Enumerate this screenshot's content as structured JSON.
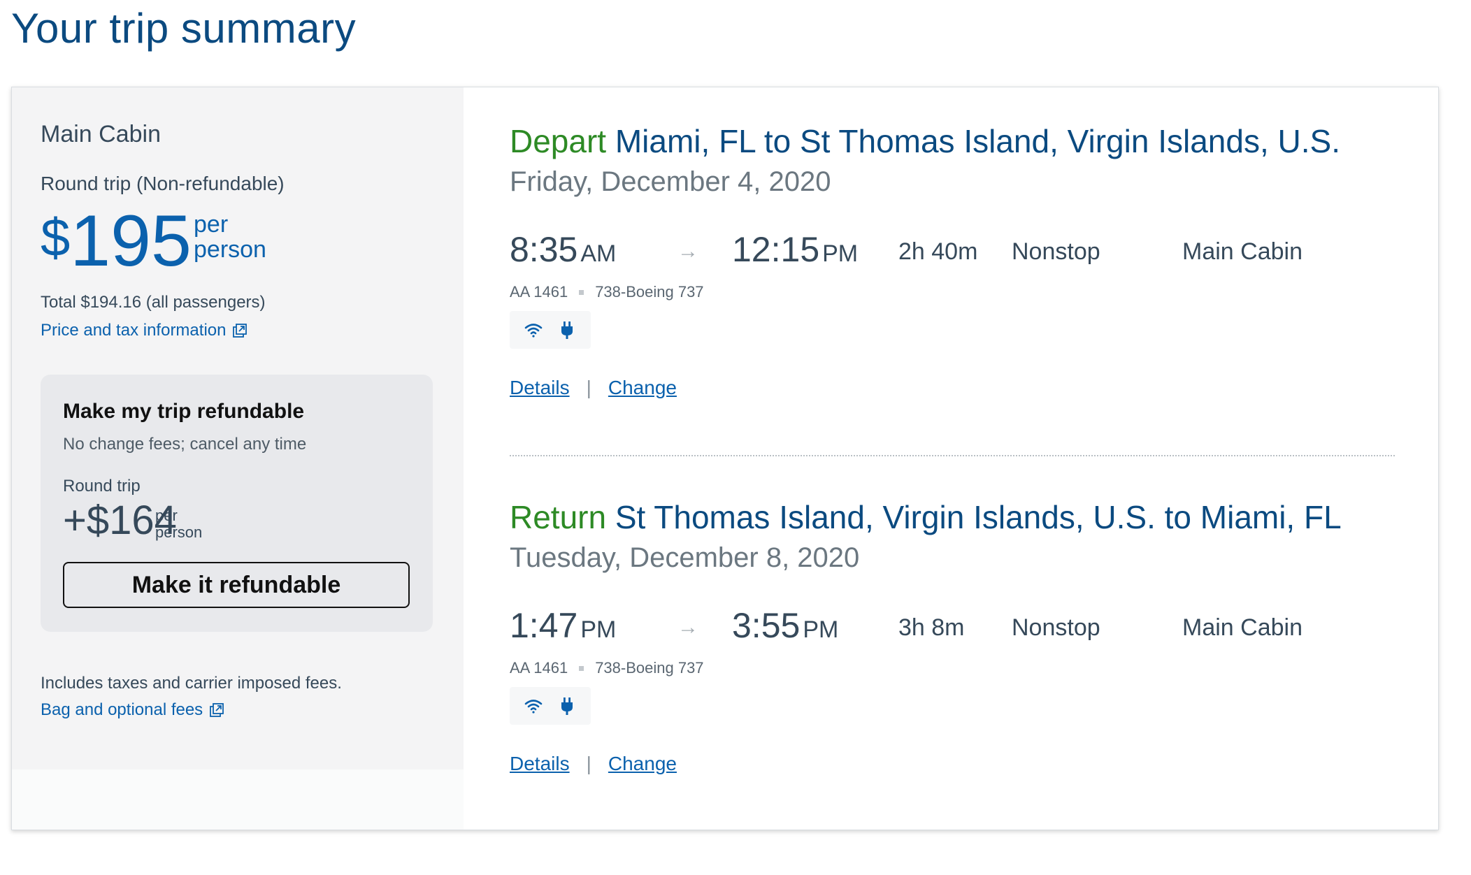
{
  "page": {
    "title": "Your trip summary"
  },
  "summary": {
    "cabin_name": "Main Cabin",
    "trip_type": "Round trip (Non-refundable)",
    "price_currency": "$",
    "price_amount": "195",
    "per_person_line1": "per",
    "per_person_line2": "person",
    "total": "Total $194.16 (all passengers)",
    "price_tax_link": "Price and tax information",
    "includes_note": "Includes taxes and carrier imposed fees.",
    "bag_fees_link": "Bag and optional fees"
  },
  "refund": {
    "title": "Make my trip refundable",
    "subtitle": "No change fees; cancel any time",
    "trip_label": "Round trip",
    "price": "+$164",
    "per_line1": "per",
    "per_line2": "person",
    "button_label": "Make it refundable"
  },
  "segments": [
    {
      "direction": "Depart",
      "route": "Miami, FL to St Thomas Island, Virgin Islands, U.S.",
      "date": "Friday, December 4, 2020",
      "depart_time": "8:35",
      "depart_ampm": "AM",
      "arrive_time": "12:15",
      "arrive_ampm": "PM",
      "duration": "2h  40m",
      "stops": "Nonstop",
      "cabin": "Main Cabin",
      "flight_number": "AA 1461",
      "aircraft": "738-Boeing 737",
      "details_link": "Details",
      "change_link": "Change"
    },
    {
      "direction": "Return",
      "route": "St Thomas Island, Virgin Islands, U.S. to Miami, FL",
      "date": "Tuesday, December 8, 2020",
      "depart_time": "1:47",
      "depart_ampm": "PM",
      "arrive_time": "3:55",
      "arrive_ampm": "PM",
      "duration": "3h  8m",
      "stops": "Nonstop",
      "cabin": "Main Cabin",
      "flight_number": "AA 1461",
      "aircraft": "738-Boeing 737",
      "details_link": "Details",
      "change_link": "Change"
    }
  ],
  "ui": {
    "link_separator": "|",
    "arrow_glyph": "→"
  },
  "icons": {
    "external_link": "external-link-icon",
    "wifi": "wifi-icon",
    "power": "power-outlet-icon",
    "arrow": "arrow-right-icon"
  },
  "colors": {
    "brand_blue": "#0b4a80",
    "link_blue": "#0b61ad",
    "depart_green": "#2d8a25",
    "sidebar_bg": "#f4f4f5",
    "refund_box_bg": "#e8e9ec"
  }
}
